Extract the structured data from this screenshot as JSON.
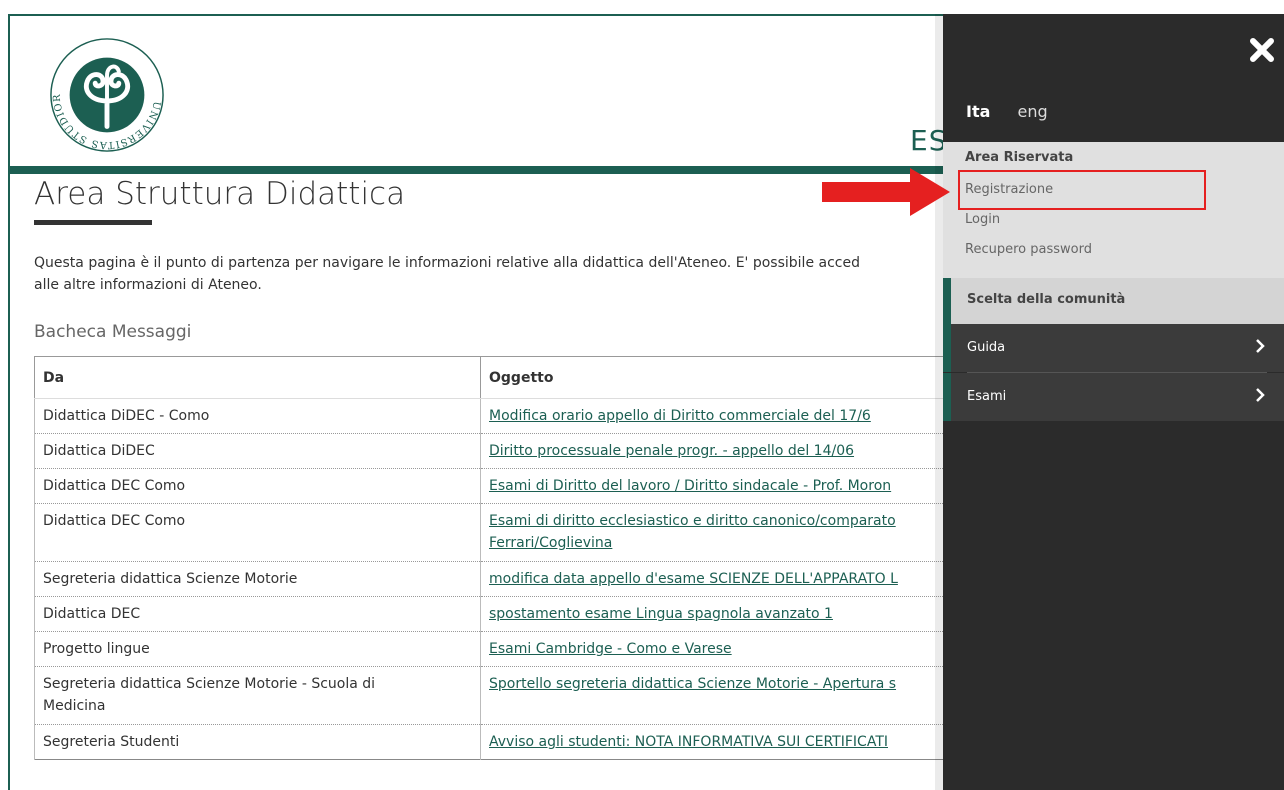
{
  "header": {
    "logo_text": "UNIVERSITAS STUDIORUM INSUBRIAE",
    "es_text": "ES"
  },
  "main": {
    "title": "Area Struttura Didattica",
    "intro_line1": "Questa pagina è il punto di partenza per navigare le informazioni relative alla didattica dell'Ateneo. E' possibile acced",
    "intro_line2": "alle altre informazioni di Ateneo.",
    "board_title": "Bacheca Messaggi",
    "table": {
      "headers": [
        "Da",
        "Oggetto"
      ],
      "rows": [
        {
          "da": "Didattica DiDEC - Como",
          "oggetto": "Modifica orario appello di Diritto commerciale del 17/6"
        },
        {
          "da": "Didattica DiDEC",
          "oggetto": "Diritto processuale penale progr. - appello del 14/06"
        },
        {
          "da": "Didattica DEC Como",
          "oggetto": "Esami di Diritto del lavoro / Diritto sindacale - Prof. Moron"
        },
        {
          "da": "Didattica DEC Como",
          "oggetto": "Esami di diritto ecclesiastico e diritto canonico/comparato",
          "oggetto2": "Ferrari/Coglievina"
        },
        {
          "da": "Segreteria didattica Scienze Motorie",
          "oggetto": "modifica data appello d'esame SCIENZE DELL'APPARATO L"
        },
        {
          "da": "Didattica DEC",
          "oggetto": "spostamento esame Lingua spagnola avanzato 1"
        },
        {
          "da": "Progetto lingue",
          "oggetto": "Esami Cambridge - Como e Varese"
        },
        {
          "da": "Segreteria didattica Scienze Motorie - Scuola di",
          "da2": "Medicina",
          "oggetto": "Sportello segreteria didattica Scienze Motorie - Apertura s"
        },
        {
          "da": "Segreteria Studenti",
          "oggetto": "Avviso agli studenti: NOTA INFORMATIVA SUI CERTIFICATI"
        }
      ]
    }
  },
  "sidenav": {
    "lang_ita": "Ita",
    "lang_eng": "eng",
    "reserved_title": "Area Riservata",
    "reserved_links": [
      "Registrazione",
      "Login",
      "Recupero password"
    ],
    "community": "Scelta della comunità",
    "items": [
      "Guida",
      "Esami"
    ]
  },
  "colors": {
    "brand": "#1c5f52",
    "sidenav_bg": "#2b2b2b",
    "highlight": "#e52020"
  },
  "icons": [
    "close-icon",
    "chevron-right-icon",
    "red-arrow-icon",
    "university-logo"
  ]
}
